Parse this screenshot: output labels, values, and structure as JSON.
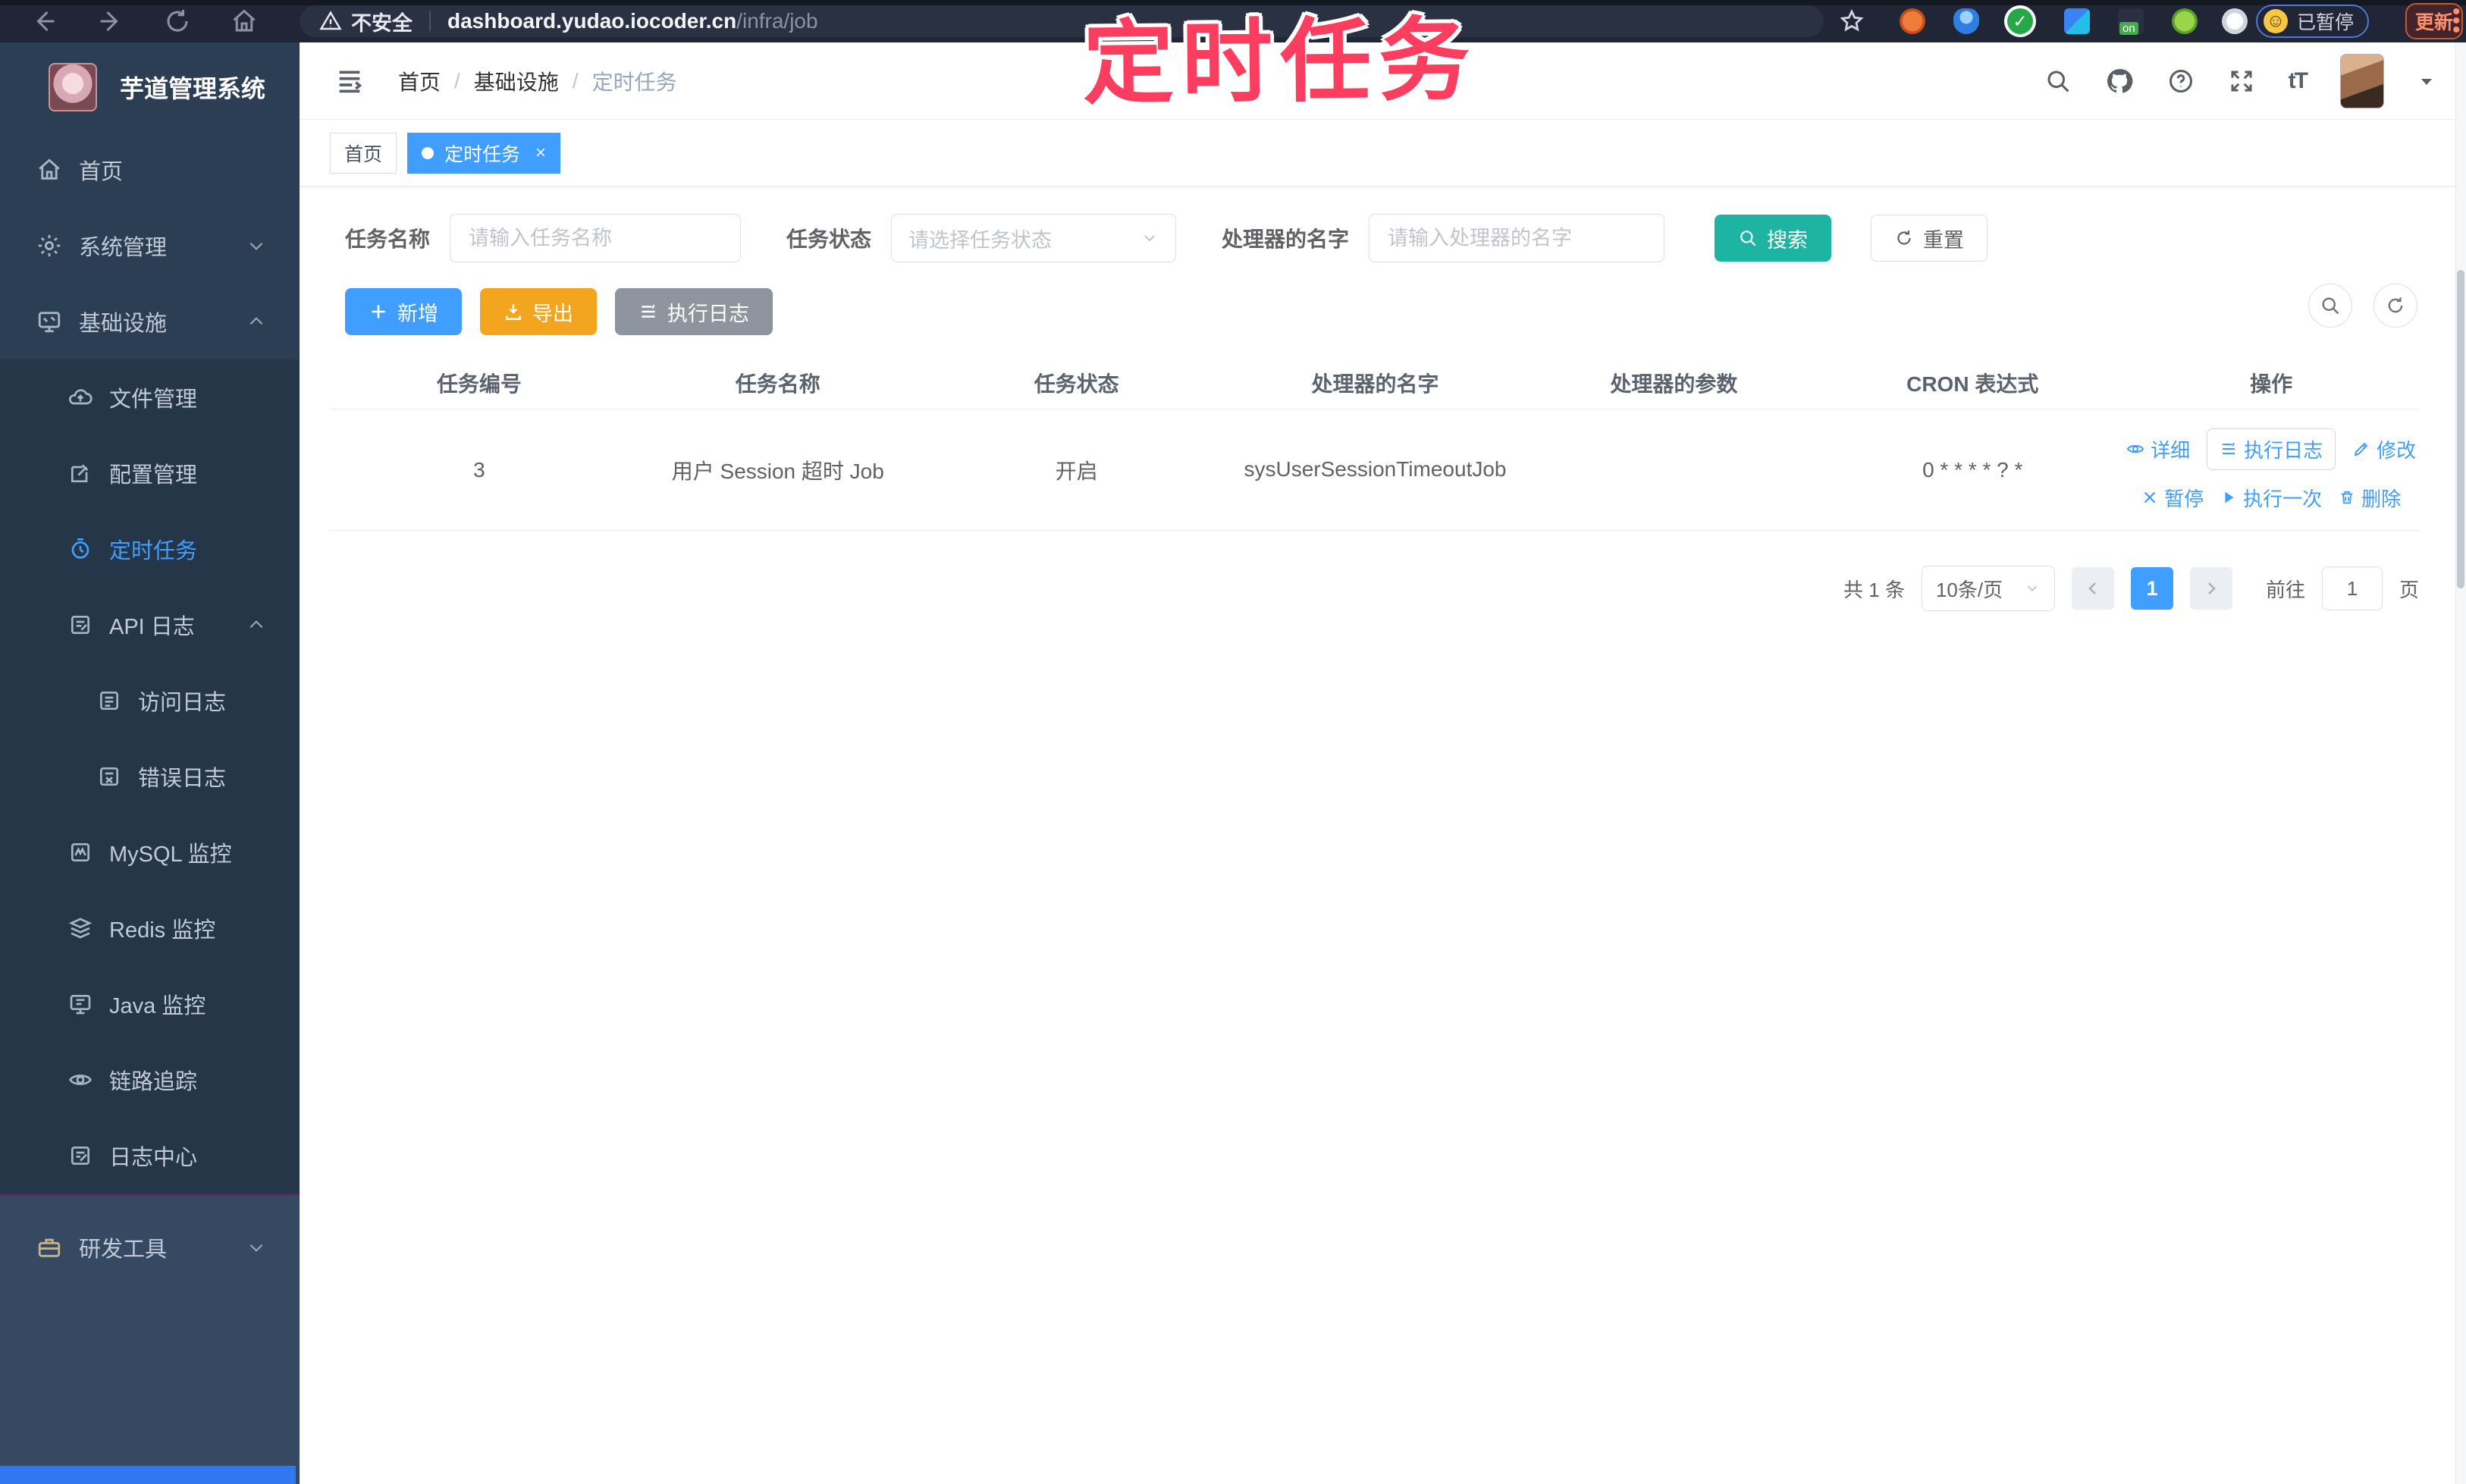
{
  "browser": {
    "security_label": "不安全",
    "url_host": "dashboard.yudao.iocoder.cn",
    "url_path": "/infra/job",
    "paused_label": "已暂停",
    "update_label": "更新",
    "extension_badge": "on"
  },
  "overlay": {
    "title": "定时任务"
  },
  "sidebar": {
    "app_title": "芋道管理系统",
    "items": [
      {
        "label": "首页",
        "icon": "home-icon"
      },
      {
        "label": "系统管理",
        "icon": "gear-icon",
        "chevron": "down"
      },
      {
        "label": "基础设施",
        "icon": "infra-icon",
        "chevron": "up"
      },
      {
        "label": "文件管理",
        "icon": "cloud-upload-icon"
      },
      {
        "label": "配置管理",
        "icon": "edit-square-icon"
      },
      {
        "label": "定时任务",
        "icon": "timer-icon",
        "active": true
      },
      {
        "label": "API 日志",
        "icon": "api-log-icon",
        "chevron": "up"
      },
      {
        "label": "访问日志",
        "icon": "access-log-icon"
      },
      {
        "label": "错误日志",
        "icon": "error-log-icon"
      },
      {
        "label": "MySQL 监控",
        "icon": "mysql-icon"
      },
      {
        "label": "Redis 监控",
        "icon": "redis-icon"
      },
      {
        "label": "Java 监控",
        "icon": "java-icon"
      },
      {
        "label": "链路追踪",
        "icon": "trace-eye-icon"
      },
      {
        "label": "日志中心",
        "icon": "log-center-icon"
      },
      {
        "label": "研发工具",
        "icon": "devtools-icon",
        "chevron": "down"
      }
    ]
  },
  "breadcrumb": {
    "items": [
      "首页",
      "基础设施",
      "定时任务"
    ],
    "separator": "/"
  },
  "tabs": [
    {
      "label": "首页"
    },
    {
      "label": "定时任务",
      "close": "×"
    }
  ],
  "filters": {
    "name_label": "任务名称",
    "name_placeholder": "请输入任务名称",
    "status_label": "任务状态",
    "status_placeholder": "请选择任务状态",
    "handler_label": "处理器的名字",
    "handler_placeholder": "请输入处理器的名字",
    "search_label": "搜索",
    "reset_label": "重置"
  },
  "toolbar": {
    "add_label": "新增",
    "export_label": "导出",
    "exec_log_label": "执行日志"
  },
  "table": {
    "columns": [
      "任务编号",
      "任务名称",
      "任务状态",
      "处理器的名字",
      "处理器的参数",
      "CRON 表达式",
      "操作"
    ],
    "rows": [
      {
        "id": "3",
        "name": "用户 Session 超时 Job",
        "status": "开启",
        "handler": "sysUserSessionTimeoutJob",
        "param": "",
        "cron": "0 * * * * ? *",
        "actions": [
          "详细",
          "执行日志",
          "修改",
          "暂停",
          "执行一次",
          "删除"
        ]
      }
    ]
  },
  "pagination": {
    "total_label": "共 1 条",
    "page_size": "10条/页",
    "current_page": "1",
    "goto_label": "前往",
    "goto_value": "1",
    "page_unit": "页"
  },
  "colors": {
    "accent_blue": "#409eff",
    "teal": "#1db4a4",
    "warning_yellow": "#f3a51f",
    "info_gray": "#8f959e",
    "annotation_pink": "#fb3e5f",
    "sidebar_bg": "#2c3e53",
    "submenu_bg": "#253649"
  }
}
